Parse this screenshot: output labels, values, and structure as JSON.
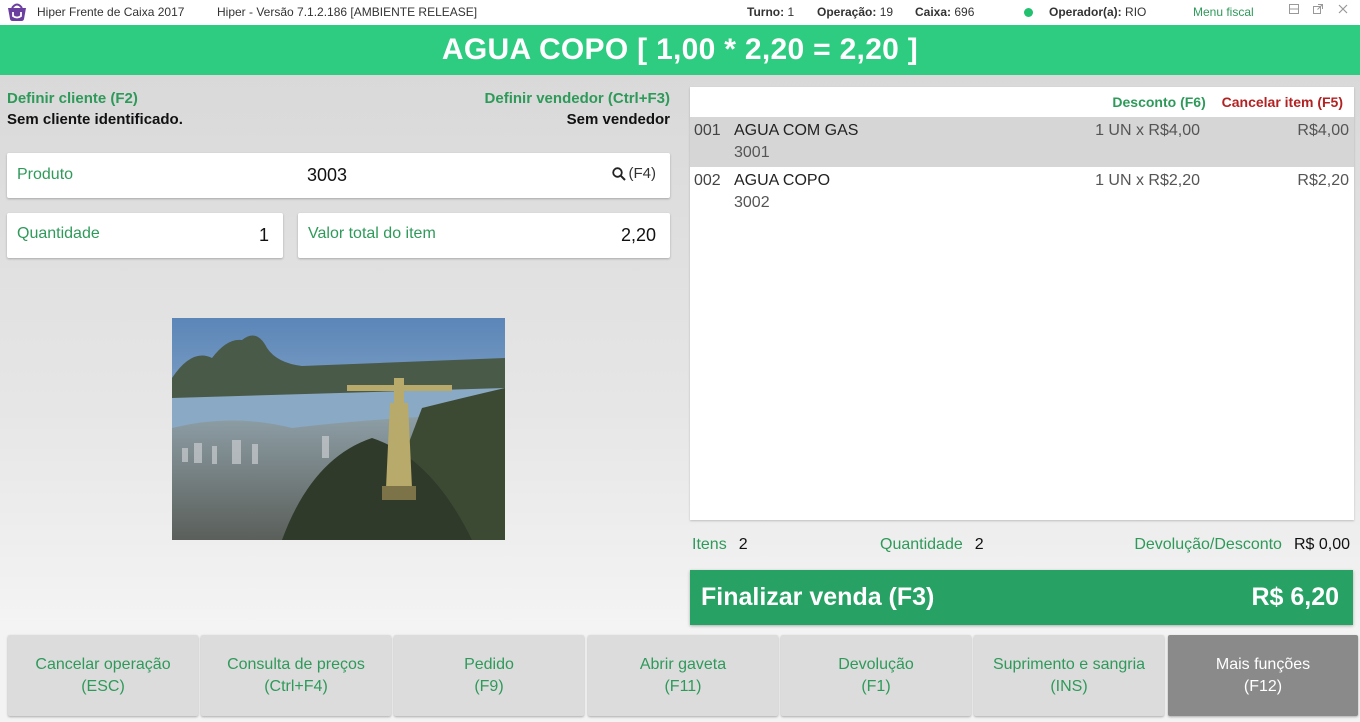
{
  "titlebar": {
    "app_title": "Hiper Frente de Caixa 2017",
    "version": "Hiper - Versão 7.1.2.186 [AMBIENTE RELEASE]",
    "turno_label": "Turno:",
    "turno_value": "1",
    "operacao_label": "Operação:",
    "operacao_value": "19",
    "caixa_label": "Caixa:",
    "caixa_value": "696",
    "operador_label": "Operador(a):",
    "operador_value": "RIO",
    "menu_fiscal": "Menu fiscal",
    "status_color": "#22c16f"
  },
  "header": {
    "current_item": "AGUA COPO [ 1,00 * 2,20 = 2,20 ]"
  },
  "left": {
    "client_link": "Definir cliente (F2)",
    "client_value": "Sem cliente identificado.",
    "seller_link": "Definir vendedor (Ctrl+F3)",
    "seller_value": "Sem vendedor",
    "produto_label": "Produto",
    "produto_value": "3003",
    "search_shortcut": "(F4)",
    "quantidade_label": "Quantidade",
    "quantidade_value": "1",
    "valor_total_label": "Valor total do item",
    "valor_total_value": "2,20"
  },
  "items": {
    "desconto": "Desconto (F6)",
    "cancelar": "Cancelar item (F5)",
    "rows": [
      {
        "seq": "001",
        "name": "AGUA COM GAS",
        "code": "3001",
        "qty": "1 UN x R$4,00",
        "price": "R$4,00"
      },
      {
        "seq": "002",
        "name": "AGUA COPO",
        "code": "3002",
        "qty": "1 UN x R$2,20",
        "price": "R$2,20"
      }
    ]
  },
  "summary": {
    "itens_label": "Itens",
    "itens_value": "2",
    "quantidade_label": "Quantidade",
    "quantidade_value": "2",
    "devolucao_label": "Devolução/Desconto",
    "devolucao_value": "R$ 0,00"
  },
  "finalizar": {
    "label": "Finalizar venda (F3)",
    "total": "R$ 6,20"
  },
  "buttons": [
    {
      "label": "Cancelar operação",
      "shortcut": "(ESC)"
    },
    {
      "label": "Consulta de preços",
      "shortcut": "(Ctrl+F4)"
    },
    {
      "label": "Pedido",
      "shortcut": "(F9)"
    },
    {
      "label": "Abrir gaveta",
      "shortcut": "(F11)"
    },
    {
      "label": "Devolução",
      "shortcut": "(F1)"
    },
    {
      "label": "Suprimento e sangria",
      "shortcut": "(INS)"
    },
    {
      "label": "Mais funções",
      "shortcut": "(F12)"
    }
  ],
  "colors": {
    "brand_green": "#2ecc80",
    "accent_green": "#2e9a5a",
    "finalizar_green": "#27a264",
    "cancel_red": "#b22222"
  },
  "icons": {
    "logo": "hiper-basket-logo",
    "search": "search-icon",
    "restore": "restore-icon",
    "popout": "popout-icon",
    "close": "close-icon"
  }
}
